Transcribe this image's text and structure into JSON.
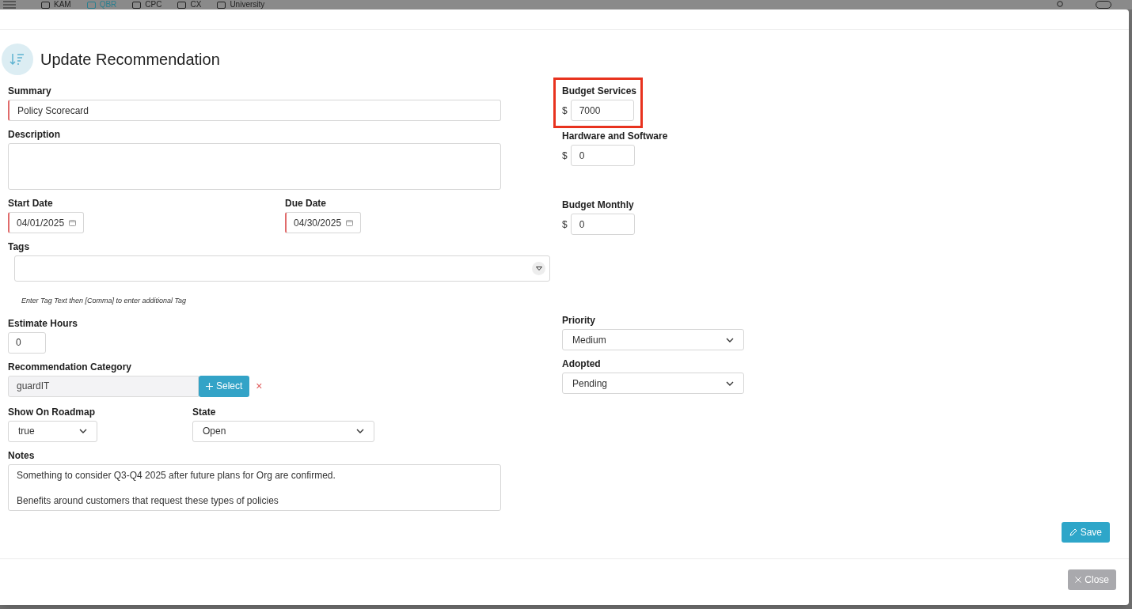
{
  "nav": {
    "items": [
      {
        "label": "KAM",
        "selected": false
      },
      {
        "label": "QBR",
        "selected": true
      },
      {
        "label": "CPC",
        "selected": false
      },
      {
        "label": "CX",
        "selected": false
      },
      {
        "label": "University",
        "selected": false
      }
    ]
  },
  "modal": {
    "title": "Update Recommendation",
    "summary": {
      "label": "Summary",
      "value": "Policy Scorecard",
      "required": true
    },
    "description": {
      "label": "Description"
    },
    "start_date": {
      "label": "Start Date",
      "value": "04/01/2025",
      "required": true
    },
    "due_date": {
      "label": "Due Date",
      "value": "04/30/2025",
      "required": true
    },
    "tags": {
      "label": "Tags",
      "hint": "Enter Tag Text then [Comma] to enter additional Tag"
    },
    "estimate_hours": {
      "label": "Estimate Hours",
      "value": "0"
    },
    "category": {
      "label": "Recommendation Category",
      "value": "guardIT",
      "button": "Select",
      "clear": "×"
    },
    "show_on_roadmap": {
      "label": "Show On Roadmap",
      "value": "true"
    },
    "state": {
      "label": "State",
      "value": "Open"
    },
    "notes": {
      "label": "Notes",
      "paragraphs": [
        "Something to consider Q3-Q4 2025 after future plans for Org are confirmed.",
        "Benefits around customers that request these types of policies"
      ]
    },
    "budgets": [
      {
        "label": "Budget Services",
        "currency": "$",
        "value": "7000",
        "highlighted": true
      },
      {
        "label": "Hardware and Software",
        "currency": "$",
        "value": "0",
        "highlighted": false
      },
      {
        "label": "Budget Monthly",
        "currency": "$",
        "value": "0",
        "highlighted": false
      }
    ],
    "priority": {
      "label": "Priority",
      "value": "Medium"
    },
    "adopted": {
      "label": "Adopted",
      "value": "Pending"
    },
    "save": "Save",
    "close": "Close"
  }
}
